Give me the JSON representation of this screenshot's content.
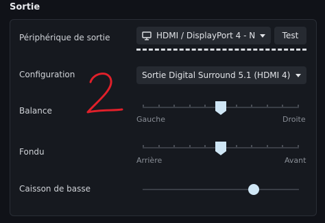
{
  "section": {
    "title": "Sortie"
  },
  "output_device": {
    "label": "Périphérique de sortie",
    "value": "HDMI / DisplayPort 4 - Na...",
    "icon": "monitor-icon",
    "test_label": "Test"
  },
  "configuration": {
    "label": "Configuration",
    "value": "Sortie Digital Surround 5.1 (HDMI 4)"
  },
  "balance": {
    "label": "Balance",
    "min_label": "Gauche",
    "max_label": "Droite",
    "value": 0.5
  },
  "fade": {
    "label": "Fondu",
    "min_label": "Arrière",
    "max_label": "Avant",
    "value": 0.5
  },
  "subwoofer": {
    "label": "Caisson de basse",
    "value": 0.71
  },
  "annotation": {
    "handwritten_text": "2",
    "color": "#e0202a"
  },
  "colors": {
    "accent": "#cfe6f5",
    "background": "#101218",
    "panel": "#16191f"
  }
}
